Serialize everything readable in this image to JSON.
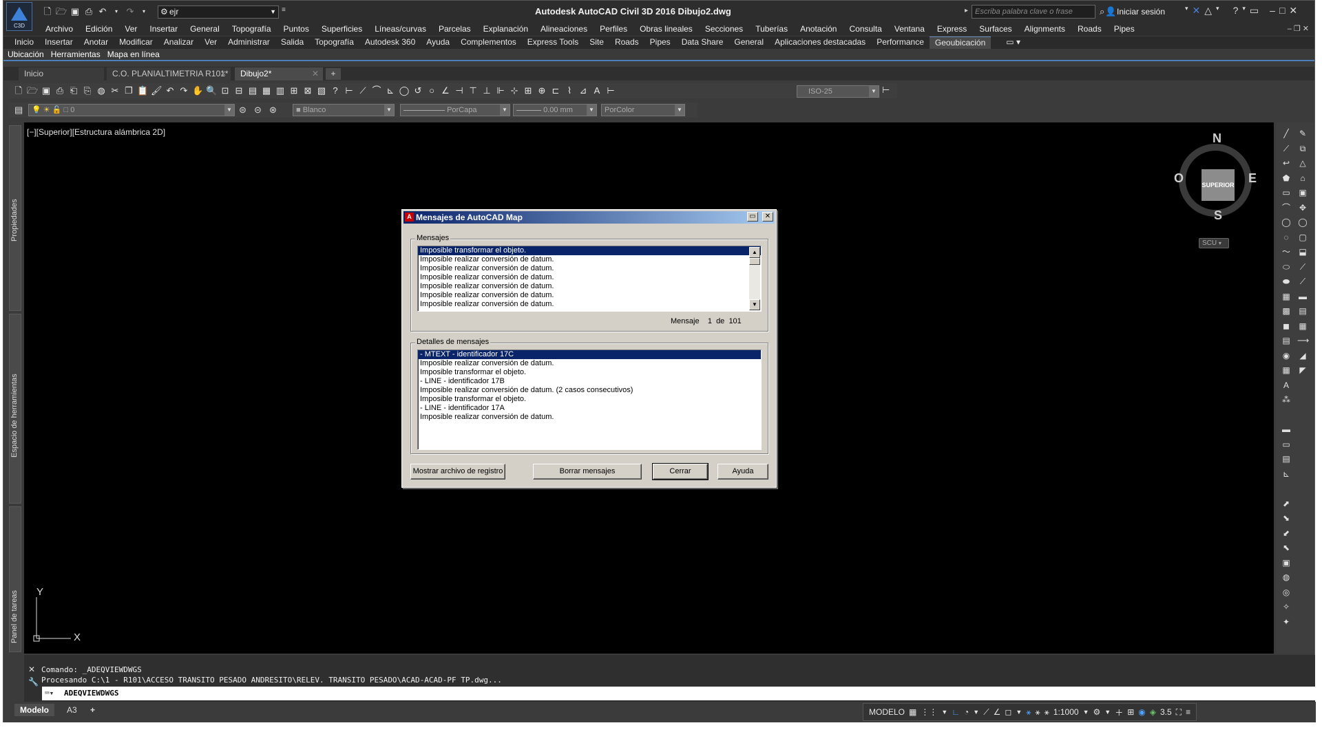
{
  "app": {
    "logo_label": "C3D",
    "title": "Autodesk AutoCAD Civil 3D 2016    Dibujo2.dwg",
    "workspace": "ejr",
    "search_placeholder": "Escriba palabra clave o frase",
    "signin": "Iniciar sesión"
  },
  "menubar": [
    "Archivo",
    "Edición",
    "Ver",
    "Insertar",
    "General",
    "Topografía",
    "Puntos",
    "Superficies",
    "Líneas/curvas",
    "Parcelas",
    "Explanación",
    "Alineaciones",
    "Perfiles",
    "Obras lineales",
    "Secciones",
    "Tuberías",
    "Anotación",
    "Consulta",
    "Ventana",
    "Express",
    "Surfaces",
    "Alignments",
    "Roads",
    "Pipes"
  ],
  "ribbon_tabs": [
    "Inicio",
    "Insertar",
    "Anotar",
    "Modificar",
    "Analizar",
    "Ver",
    "Administrar",
    "Salida",
    "Topografía",
    "Autodesk 360",
    "Ayuda",
    "Complementos",
    "Express Tools",
    "Site",
    "Roads",
    "Pipes",
    "Data Share",
    "General",
    "Aplicaciones destacadas",
    "Performance",
    "Geoubicación"
  ],
  "ribbon_active_tab": "Geoubicación",
  "ribbon_panels": [
    "Ubicación",
    "Herramientas",
    "Mapa en línea"
  ],
  "doc_tabs": [
    "Inicio",
    "C.O. PLANIALTIMETRIA R101*",
    "Dibujo2*"
  ],
  "active_doc_tab": "Dibujo2*",
  "toolbar": {
    "dimstyle": "ISO-25",
    "layer": "0",
    "color": "Blanco",
    "linetype": "PorCapa",
    "lineweight": "0.00 mm",
    "plotstyle": "PorColor"
  },
  "palettes": {
    "properties": "Propiedades",
    "tool_space": "Espacio de herramientas",
    "task_pane": "Panel de tareas"
  },
  "viewport": {
    "label": "[−][Superior][Estructura alámbrica 2D]",
    "viewcube_face": "SUPERIOR",
    "compass": {
      "n": "N",
      "s": "S",
      "e": "E",
      "w": "O"
    },
    "ucs_label": "SCU",
    "ucs_x": "X",
    "ucs_y": "Y"
  },
  "dialog": {
    "title": "Mensajes de AutoCAD Map",
    "messages_label": "Mensajes",
    "messages": [
      "Imposible transformar el objeto.",
      "Imposible realizar conversión de datum.",
      "Imposible realizar conversión de datum.",
      "Imposible realizar conversión de datum.",
      "Imposible realizar conversión de datum.",
      "Imposible realizar conversión de datum.",
      "Imposible realizar conversión de datum."
    ],
    "counter_label": "Mensaje",
    "counter_current": "1",
    "counter_of": "de",
    "counter_total": "101",
    "details_label": "Detalles de mensajes",
    "details": [
      "- MTEXT - identificador 17C",
      "Imposible realizar conversión de datum.",
      "Imposible transformar el objeto.",
      "- LINE - identificador 17B",
      "Imposible realizar conversión de datum. (2 casos consecutivos)",
      "Imposible transformar el objeto.",
      "- LINE - identificador 17A",
      "Imposible realizar conversión de datum."
    ],
    "buttons": {
      "show_log": "Mostrar archivo de registro",
      "clear": "Borrar mensajes",
      "close": "Cerrar",
      "help": "Ayuda"
    }
  },
  "command": {
    "history": [
      "Comando: _ADEQVIEWDWGS",
      "Procesando C:\\1 - R101\\ACCESO TRANSITO PESADO ANDRESITO\\RELEV. TRANSITO PESADO\\ACAD-ACAD-PF TP.dwg..."
    ],
    "input": "ADEQVIEWDWGS"
  },
  "status": {
    "layout_tabs": [
      "Modelo",
      "A3"
    ],
    "model": "MODELO",
    "scale": "1:1000",
    "annot_scale": "3.5"
  },
  "colors": {
    "canvas": "#000000",
    "ui_dark": "#3b3b3b",
    "dialog_face": "#d4d0c8",
    "selection": "#0a246a",
    "accent": "#4f7fb8"
  }
}
